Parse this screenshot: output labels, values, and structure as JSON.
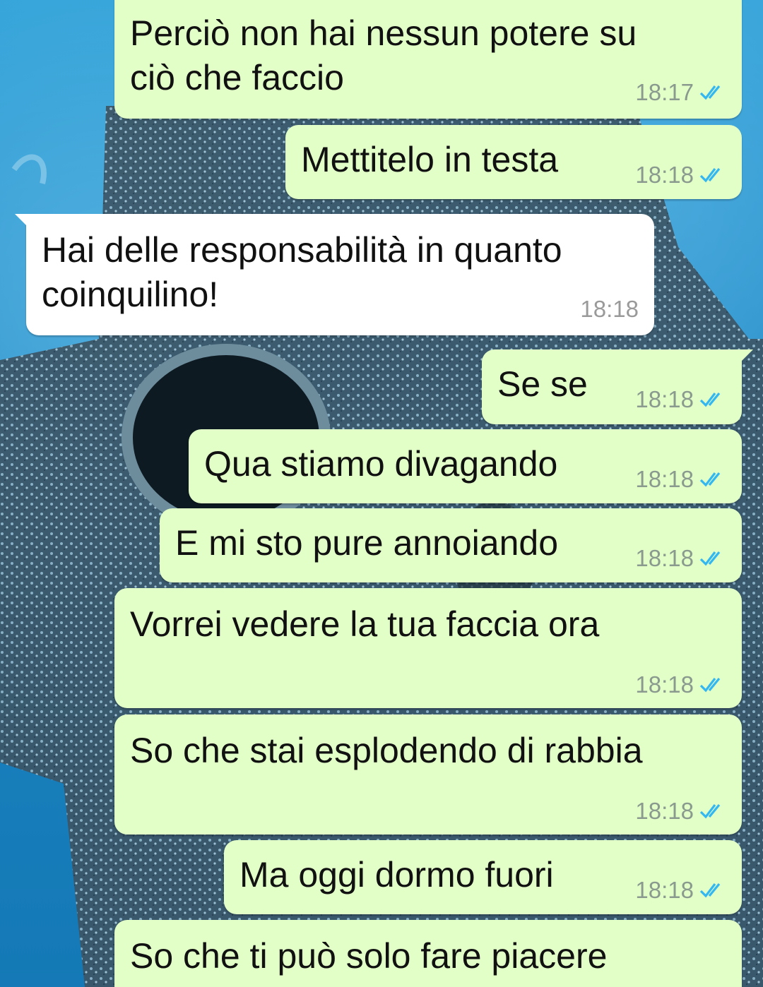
{
  "messages": [
    {
      "direction": "outgoing",
      "lines": [
        "Perciò non hai nessun potere su",
        "ciò che faccio"
      ],
      "time": "18:17",
      "status": "read"
    },
    {
      "direction": "outgoing",
      "lines": [
        "Mettitelo in testa"
      ],
      "time": "18:18",
      "status": "read"
    },
    {
      "direction": "incoming",
      "lines": [
        "Hai delle responsabilità in quanto",
        "coinquilino!"
      ],
      "time": "18:18"
    },
    {
      "direction": "outgoing",
      "lines": [
        "Se se"
      ],
      "time": "18:18",
      "status": "read"
    },
    {
      "direction": "outgoing",
      "lines": [
        "Qua stiamo divagando"
      ],
      "time": "18:18",
      "status": "read"
    },
    {
      "direction": "outgoing",
      "lines": [
        "E mi sto pure annoiando"
      ],
      "time": "18:18",
      "status": "read"
    },
    {
      "direction": "outgoing",
      "lines": [
        "Vorrei vedere la tua faccia ora"
      ],
      "time": "18:18",
      "status": "read"
    },
    {
      "direction": "outgoing",
      "lines": [
        "So che stai esplodendo di rabbia"
      ],
      "time": "18:18",
      "status": "read"
    },
    {
      "direction": "outgoing",
      "lines": [
        "Ma oggi dormo fuori"
      ],
      "time": "18:18",
      "status": "read"
    },
    {
      "direction": "outgoing",
      "lines": [
        "So che ti può solo fare piacere"
      ],
      "time": "",
      "status": ""
    }
  ],
  "colors": {
    "outgoing_bubble": "#e1ffc7",
    "incoming_bubble": "#ffffff",
    "read_tick": "#34b7f1",
    "wallpaper": "#1d86c2"
  },
  "icons": {
    "read_status": "double-check-icon"
  }
}
